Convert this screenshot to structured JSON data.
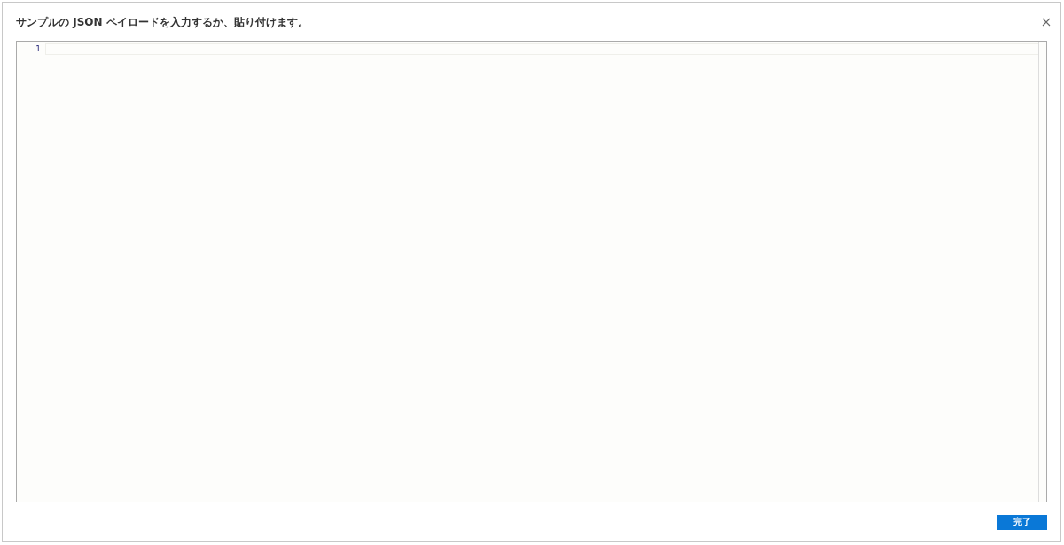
{
  "dialog": {
    "title": "サンプルの JSON ペイロードを入力するか、貼り付けます。"
  },
  "editor": {
    "line_numbers": [
      "1"
    ]
  },
  "buttons": [
    {
      "label": "完了"
    }
  ]
}
